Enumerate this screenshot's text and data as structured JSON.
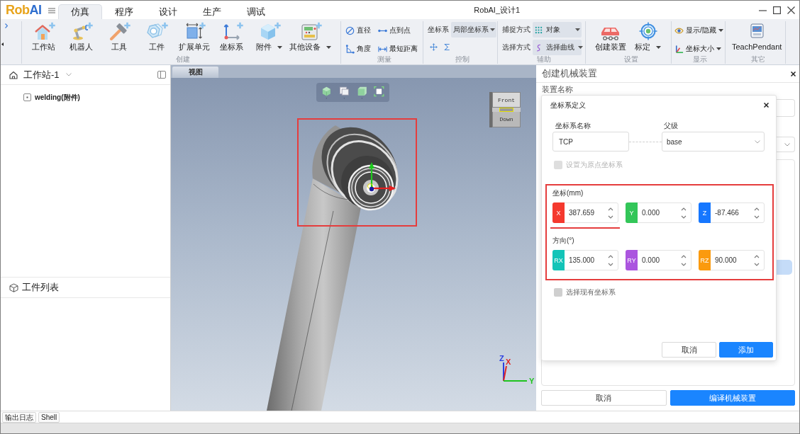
{
  "window": {
    "title": "RobAI_设计1"
  },
  "logo": [
    {
      "text": "Rob",
      "color": "#e8a41c"
    },
    {
      "text": "AI",
      "color": "#2f6fcf"
    }
  ],
  "tabs": [
    {
      "label": "仿真",
      "selected": true
    },
    {
      "label": "程序",
      "selected": false
    },
    {
      "label": "设计",
      "selected": false
    },
    {
      "label": "生产",
      "selected": false
    },
    {
      "label": "调试",
      "selected": false
    }
  ],
  "ribbon": {
    "groups": [
      {
        "kind": "large",
        "label": "创建",
        "items": [
          {
            "label": "工作站",
            "dropdown": false
          },
          {
            "label": "机器人",
            "dropdown": false
          },
          {
            "label": "工具",
            "dropdown": false
          },
          {
            "label": "工件",
            "dropdown": false
          },
          {
            "label": "扩展单元",
            "dropdown": false
          },
          {
            "label": "坐标系",
            "dropdown": false
          },
          {
            "label": "附件",
            "dropdown": true
          },
          {
            "label": "其他设备",
            "dropdown": true
          }
        ]
      },
      {
        "kind": "small",
        "label": "测量",
        "items": [
          {
            "label": "直径",
            "dropdown": false
          },
          {
            "label": "点到点",
            "dropdown": false
          },
          {
            "label": "角度",
            "dropdown": false
          },
          {
            "label": "最短距离",
            "dropdown": false
          }
        ]
      },
      {
        "kind": "control",
        "label": "控制",
        "fields": [
          {
            "label": "坐标系",
            "value": "局部坐标系"
          }
        ]
      },
      {
        "kind": "fields",
        "label": "辅助",
        "fields": [
          {
            "label": "捕捉方式",
            "value": "对象"
          },
          {
            "label": "选择方式",
            "value": "选择曲线"
          }
        ]
      },
      {
        "kind": "large",
        "label": "设置",
        "items": [
          {
            "label": "创建装置",
            "dropdown": false
          },
          {
            "label": "标定",
            "dropdown": true
          }
        ]
      },
      {
        "kind": "small",
        "label": "显示",
        "items": [
          {
            "label": "显示/隐藏",
            "dropdown": true
          },
          {
            "label": "坐标大小",
            "dropdown": true
          }
        ]
      },
      {
        "kind": "large",
        "label": "其它",
        "items": [
          {
            "label": "TeachPendant",
            "dropdown": false
          }
        ]
      }
    ]
  },
  "workstation": {
    "title": "工作站-1",
    "tree": [
      {
        "label": "welding(附件)"
      }
    ]
  },
  "parts_list": {
    "title": "工件列表"
  },
  "viewport": {
    "tab": "视图",
    "view_cube": {
      "top": "Front",
      "front": "Down"
    },
    "axes": [
      {
        "label": "Z",
        "color": "#2b3fe0"
      },
      {
        "label": "X",
        "color": "#e02424"
      },
      {
        "label": "Y",
        "color": "#1fc41f"
      }
    ]
  },
  "mechanism_panel": {
    "title": "创建机械装置",
    "name_label": "装置名称",
    "buttons": [
      {
        "label": "取消",
        "kind": "secondary"
      },
      {
        "label": "编译机械装置",
        "kind": "primary"
      }
    ]
  },
  "frame_dialog": {
    "title": "坐标系定义",
    "name_field": {
      "label": "坐标系名称",
      "value": "TCP"
    },
    "parent_field": {
      "label": "父级",
      "value": "base"
    },
    "origin_checkbox": {
      "label": "设置为原点坐标系",
      "checked": false,
      "disabled": true
    },
    "sections": [
      {
        "label": "坐标(mm)",
        "fields": [
          {
            "axis": "X",
            "value": "387.659",
            "color": "#f5392e"
          },
          {
            "axis": "Y",
            "value": "0.000",
            "color": "#33c659"
          },
          {
            "axis": "Z",
            "value": "-87.466",
            "color": "#1677ff"
          }
        ]
      },
      {
        "label": "方向(°)",
        "fields": [
          {
            "axis": "RX",
            "value": "135.000",
            "color": "#13c4b8"
          },
          {
            "axis": "RY",
            "value": "0.000",
            "color": "#ab55df"
          },
          {
            "axis": "RZ",
            "value": "90.000",
            "color": "#fb9a0e"
          }
        ]
      }
    ],
    "existing_checkbox": {
      "label": "选择现有坐标系",
      "checked": false,
      "disabled": false
    },
    "buttons": [
      {
        "label": "取消",
        "kind": "secondary"
      },
      {
        "label": "添加",
        "kind": "primary"
      }
    ]
  },
  "status_bar": {
    "tabs": [
      {
        "label": "输出日志"
      },
      {
        "label": "Shell"
      }
    ]
  }
}
